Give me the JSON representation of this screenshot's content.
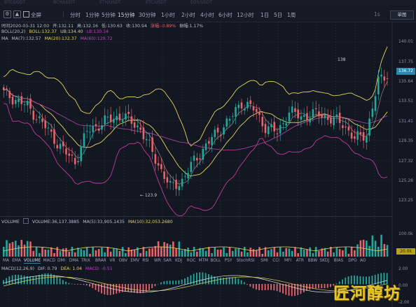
{
  "tabs": [
    "BTC/USDT",
    "BCH/USDT",
    "ETH/USDT",
    "ETC/USDT",
    "EOS/USDT"
  ],
  "toolbar": {
    "items": [
      {
        "label": "⚙",
        "kind": "icon",
        "name": "settings-icon"
      },
      {
        "label": "▲",
        "kind": "icon",
        "name": "compare-icon"
      },
      {
        "label": "全屏",
        "kind": "text",
        "name": "fullscreen-button"
      },
      {
        "label": "|",
        "kind": "sep"
      },
      {
        "label": "分时",
        "kind": "text",
        "name": "interval-timeline"
      },
      {
        "label": "1分钟",
        "kind": "text",
        "name": "interval-1m"
      },
      {
        "label": "5分钟",
        "kind": "text",
        "name": "interval-5m"
      },
      {
        "label": "15分钟",
        "kind": "text",
        "name": "interval-15m",
        "active": true
      },
      {
        "label": "30分钟",
        "kind": "text",
        "name": "interval-30m"
      },
      {
        "label": "1小时",
        "kind": "text",
        "name": "interval-1h"
      },
      {
        "label": "2小时",
        "kind": "text",
        "name": "interval-2h"
      },
      {
        "label": "4小时",
        "kind": "text",
        "name": "interval-4h"
      },
      {
        "label": "6小时",
        "kind": "text",
        "name": "interval-6h"
      },
      {
        "label": "12小时",
        "kind": "text",
        "name": "interval-12h"
      },
      {
        "label": "1日",
        "kind": "text",
        "name": "interval-1d"
      },
      {
        "label": "5日",
        "kind": "text",
        "name": "interval-5d"
      },
      {
        "label": "1周",
        "kind": "text",
        "name": "interval-1w"
      }
    ],
    "right_btn": "单图",
    "zoom_label": "1s"
  },
  "ohlc_line": {
    "time": "时间2020-03-31 12:00",
    "open": "开:132.11",
    "high": "高:132.16",
    "low": "低:130.63",
    "close": "收:130.94",
    "change": "涨幅:-0.89%",
    "amp": "振幅:1.17%"
  },
  "boll_line": {
    "name": "BOLL(20,2)",
    "mid": "BOLL:132.37",
    "ub": "UB:134.40",
    "lb": "LB:130.34"
  },
  "ma_line": {
    "name": "MA",
    "ma1": "MA(7):132.57",
    "ma2": "MA(20):132.37",
    "ma3": "MA(60):129.72"
  },
  "price_axis": [
    "140.01",
    "137.75",
    "135.64",
    "133.51",
    "131.41",
    "129.35",
    "127.32",
    "125.28",
    "123.25"
  ],
  "price_tag": "136.72",
  "high_mark": "138",
  "low_mark": "← 123.9",
  "volume_line": {
    "name": "VOLUME",
    "vol": "VOLUME:36,137.3885",
    "ma5": "MA(5):33,905.1435",
    "ma10": "MA(10):32,053.2680"
  },
  "volume_axis": "100.0k",
  "volume_tag": "20.0k",
  "indicators": [
    "MA",
    "EMA",
    "VOLUME",
    "MACD",
    "DMI",
    "DMA",
    "TRIX",
    "BRAR",
    "VR",
    "OBV",
    "EMV",
    "RSI",
    "WR",
    "SAR",
    "KDJ",
    "ROC",
    "MTM",
    "BOLL",
    "PSY",
    "StochRSI",
    "SMI",
    "CCI",
    "MFI",
    "ATR",
    "BBW",
    "SKDJ",
    "BIAS",
    "DPO",
    "AO"
  ],
  "active_indicator": "VOLUME",
  "macd_line": {
    "name": "MACD(12,26,9)",
    "dif": "DIF: 0.79",
    "dea": "DEA: 1.04",
    "macd": "MACD: -0.51"
  },
  "macd_axis": [
    "2.00",
    "0.00",
    "-2.00"
  ],
  "watermark": "匠河醇坊",
  "colors": {
    "up": "#e8636b",
    "down": "#26a69a",
    "mid": "#e0d35c",
    "ub": "#c93cc9",
    "lb": "#c23a9a",
    "ma7": "#d4c25a",
    "ma20": "#a93fa0",
    "bg": "#131722"
  }
}
